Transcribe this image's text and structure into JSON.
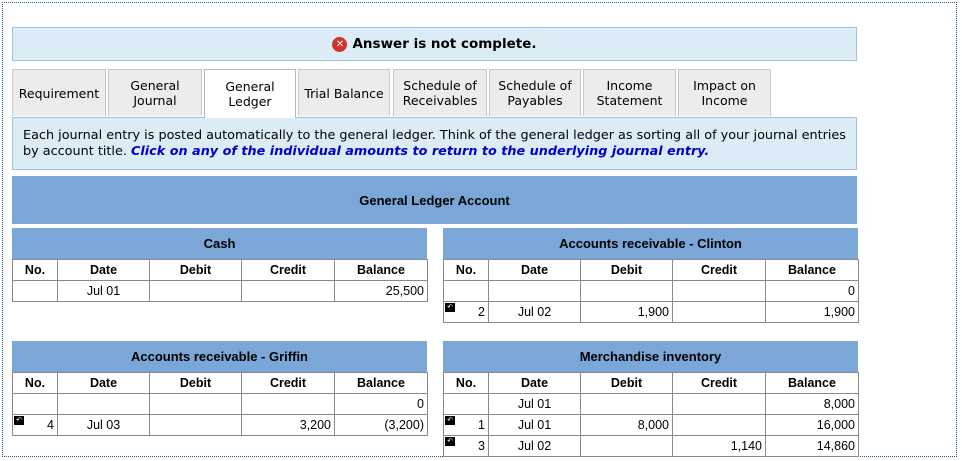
{
  "alert": {
    "text": "Answer is not complete.",
    "icon": "x-circle-icon"
  },
  "tabs": [
    {
      "label": "Requirement"
    },
    {
      "label": "General\nJournal"
    },
    {
      "label": "General\nLedger"
    },
    {
      "label": "Trial Balance"
    },
    {
      "label": "Schedule of\nReceivables"
    },
    {
      "label": "Schedule of\nPayables"
    },
    {
      "label": "Income\nStatement"
    },
    {
      "label": "Impact on\nIncome"
    }
  ],
  "info": {
    "text": "Each journal entry is posted automatically to the general ledger. Think of the general ledger as sorting all of your journal entries by account title.",
    "link_text": "Click on any of the individual amounts to return to the underlying journal entry."
  },
  "ledger_title": "General Ledger Account",
  "columns": {
    "no": "No.",
    "date": "Date",
    "debit": "Debit",
    "credit": "Credit",
    "balance": "Balance"
  },
  "accounts": {
    "cash": {
      "title": "Cash",
      "rows": [
        {
          "no": "",
          "date": "Jul 01",
          "debit": "",
          "credit": "",
          "balance": "25,500"
        }
      ]
    },
    "ar_clinton": {
      "title": "Accounts receivable - Clinton",
      "rows": [
        {
          "no": "",
          "date": "",
          "debit": "",
          "credit": "",
          "balance": "0"
        },
        {
          "no": "2",
          "date": "Jul 02",
          "debit": "1,900",
          "credit": "",
          "balance": "1,900"
        }
      ]
    },
    "ar_griffin": {
      "title": "Accounts receivable - Griffin",
      "rows": [
        {
          "no": "",
          "date": "",
          "debit": "",
          "credit": "",
          "balance": "0"
        },
        {
          "no": "4",
          "date": "Jul 03",
          "debit": "",
          "credit": "3,200",
          "balance": "(3,200)"
        }
      ]
    },
    "inventory": {
      "title": "Merchandise inventory",
      "rows": [
        {
          "no": "",
          "date": "Jul 01",
          "debit": "",
          "credit": "",
          "balance": "8,000"
        },
        {
          "no": "1",
          "date": "Jul 01",
          "debit": "8,000",
          "credit": "",
          "balance": "16,000"
        },
        {
          "no": "3",
          "date": "Jul 02",
          "debit": "",
          "credit": "1,140",
          "balance": "14,860"
        }
      ]
    }
  }
}
